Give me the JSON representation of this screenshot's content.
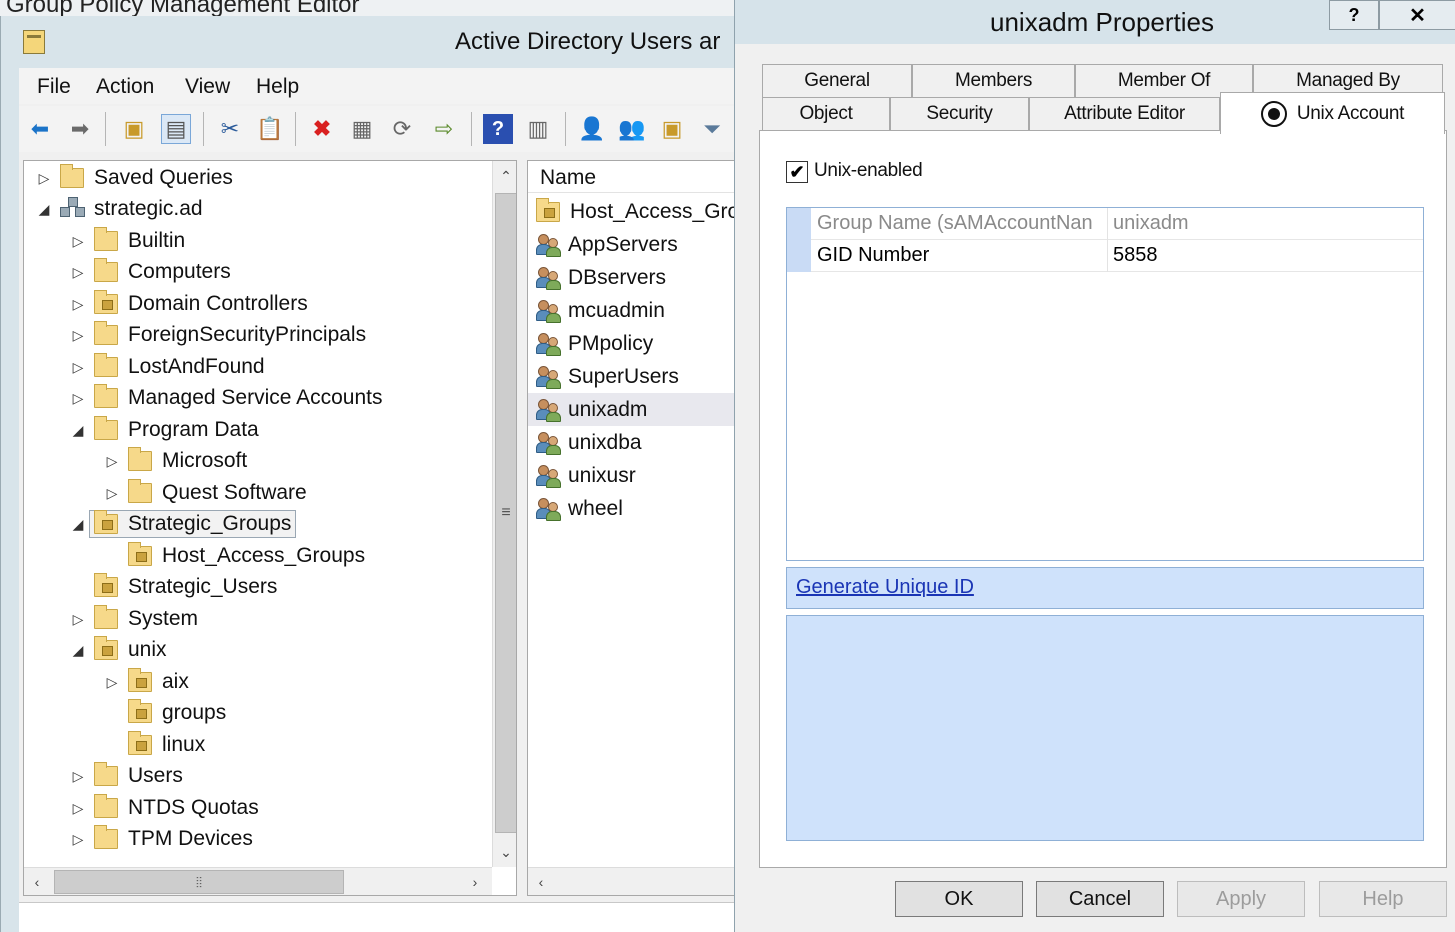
{
  "background_window": {
    "title": "Group Policy Management Editor"
  },
  "aduc": {
    "title": "Active Directory Users ar",
    "menu": [
      "File",
      "Action",
      "View",
      "Help"
    ],
    "tree": [
      {
        "label": "Saved Queries",
        "expander": "▷"
      },
      {
        "label": "strategic.ad",
        "expander": "◢"
      },
      {
        "label": "Builtin",
        "expander": "▷"
      },
      {
        "label": "Computers",
        "expander": "▷"
      },
      {
        "label": "Domain Controllers",
        "expander": "▷"
      },
      {
        "label": "ForeignSecurityPrincipals",
        "expander": "▷"
      },
      {
        "label": "LostAndFound",
        "expander": "▷"
      },
      {
        "label": "Managed Service Accounts",
        "expander": "▷"
      },
      {
        "label": "Program Data",
        "expander": "◢"
      },
      {
        "label": "Microsoft",
        "expander": "▷"
      },
      {
        "label": "Quest Software",
        "expander": "▷"
      },
      {
        "label": "Strategic_Groups",
        "expander": "◢"
      },
      {
        "label": "Host_Access_Groups",
        "expander": ""
      },
      {
        "label": "Strategic_Users",
        "expander": ""
      },
      {
        "label": "System",
        "expander": "▷"
      },
      {
        "label": "unix",
        "expander": "◢"
      },
      {
        "label": "aix",
        "expander": "▷"
      },
      {
        "label": "groups",
        "expander": ""
      },
      {
        "label": "linux",
        "expander": ""
      },
      {
        "label": "Users",
        "expander": "▷"
      },
      {
        "label": "NTDS Quotas",
        "expander": "▷"
      },
      {
        "label": "TPM Devices",
        "expander": "▷"
      }
    ],
    "list": {
      "column_name": "Name",
      "items": [
        "Host_Access_Grou",
        "AppServers",
        "DBservers",
        "mcuadmin",
        "PMpolicy",
        "SuperUsers",
        "unixadm",
        "unixdba",
        "unixusr",
        "wheel"
      ]
    }
  },
  "dialog": {
    "title": "unixadm Properties",
    "help_glyph": "?",
    "close_glyph": "✕",
    "tabs_top": [
      "General",
      "Members",
      "Member Of",
      "Managed By"
    ],
    "tabs_bottom": [
      "Object",
      "Security",
      "Attribute Editor",
      "Unix Account"
    ],
    "unix_enabled": {
      "label": "Unix-enabled",
      "checked": true,
      "glyph": "✔"
    },
    "grid": [
      {
        "name": "Group Name (sAMAccountNan",
        "value": "unixadm",
        "readonly": true
      },
      {
        "name": "GID Number",
        "value": "5858",
        "readonly": false
      }
    ],
    "generate_link": "Generate Unique ID",
    "buttons": {
      "ok": "OK",
      "cancel": "Cancel",
      "apply": "Apply",
      "help": "Help"
    }
  }
}
